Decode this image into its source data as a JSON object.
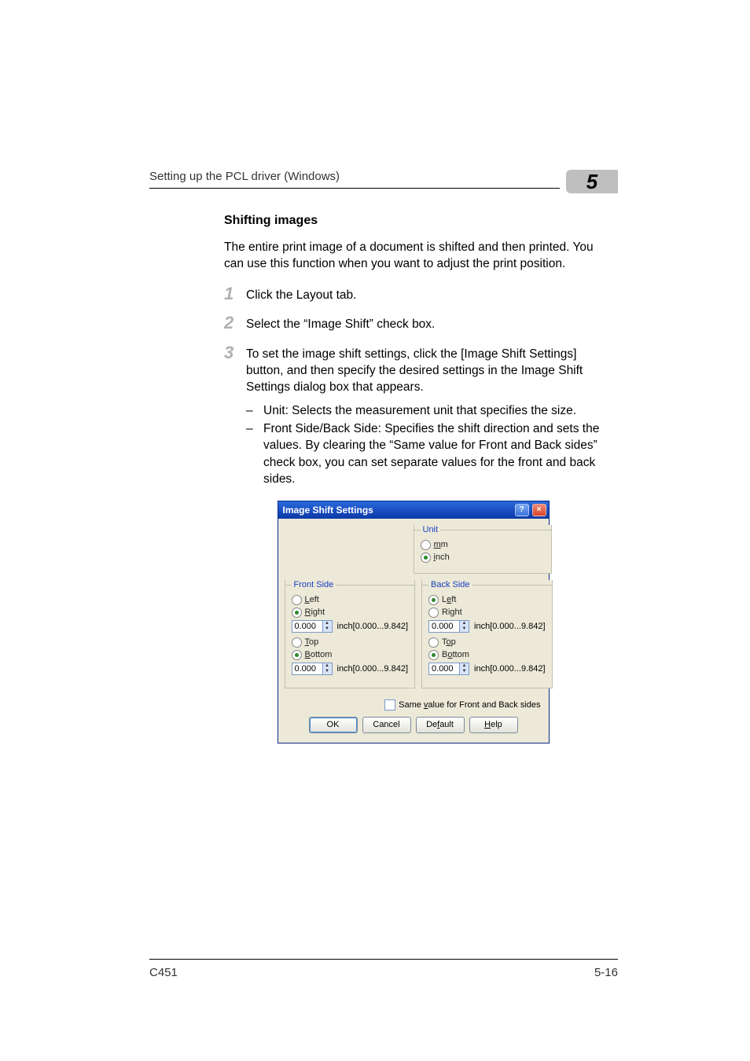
{
  "header": {
    "running_title": "Setting up the PCL driver (Windows)",
    "chapter_number": "5"
  },
  "section_heading": "Shifting images",
  "intro_paragraph": "The entire print image of a document is shifted and then printed. You can use this function when you want to adjust the print position.",
  "steps": [
    {
      "num": "1",
      "text": "Click the Layout tab."
    },
    {
      "num": "2",
      "text": "Select the “Image Shift” check box."
    },
    {
      "num": "3",
      "text": "To set the image shift settings, click the [Image Shift Settings] button, and then specify the desired settings in the Image Shift Settings dialog box that appears.",
      "subitems": [
        "Unit: Selects the measurement unit that specifies the size.",
        "Front Side/Back Side: Specifies the shift direction and sets the values. By clearing the “Same value for Front and Back sides” check box, you can set separate values for the front and back sides."
      ]
    }
  ],
  "dialog": {
    "title": "Image Shift Settings",
    "unit": {
      "legend": "Unit",
      "options": [
        {
          "label_pre": "",
          "ul": "m",
          "label_post": "m",
          "selected": false
        },
        {
          "label_pre": "",
          "ul": "i",
          "label_post": "nch",
          "selected": true
        }
      ]
    },
    "front": {
      "legend": "Front Side",
      "left": {
        "ul": "L",
        "rest": "eft",
        "selected": false
      },
      "right": {
        "ul": "R",
        "rest": "ight",
        "selected": true
      },
      "horiz_value": "0.000",
      "horiz_suffix": "inch[0.000...9.842]",
      "top": {
        "ul": "T",
        "rest": "op",
        "selected": false
      },
      "bottom": {
        "ul": "B",
        "rest": "ottom",
        "selected": true
      },
      "vert_value": "0.000",
      "vert_suffix": "inch[0.000...9.842]"
    },
    "back": {
      "legend": "Back Side",
      "left": {
        "pre": "L",
        "ul": "e",
        "rest": "ft",
        "selected": true
      },
      "right": {
        "pre": "Ri",
        "ul": "g",
        "rest": "ht",
        "selected": false
      },
      "horiz_value": "0.000",
      "horiz_suffix": "inch[0.000...9.842]",
      "top": {
        "pre": "T",
        "ul": "o",
        "rest": "p",
        "selected": false
      },
      "bottom": {
        "pre": "B",
        "ul": "o",
        "rest": "ttom",
        "selected": true
      },
      "vert_value": "0.000",
      "vert_suffix": "inch[0.000...9.842]"
    },
    "same_value": {
      "checked": false,
      "label_pre": "Same ",
      "label_ul": "v",
      "label_post": "alue for Front and Back sides"
    },
    "buttons": {
      "ok": "OK",
      "cancel": "Cancel",
      "default_pre": "De",
      "default_ul": "f",
      "default_post": "ault",
      "help_ul": "H",
      "help_post": "elp"
    }
  },
  "footer": {
    "left": "C451",
    "right": "5-16"
  }
}
